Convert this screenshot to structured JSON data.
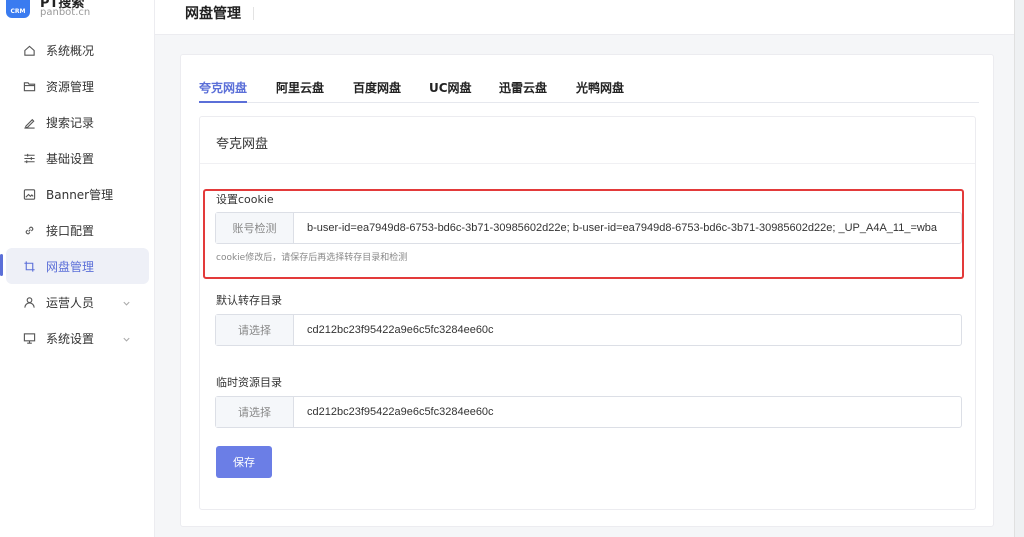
{
  "brand": {
    "logo_text": "CRM",
    "title": "PT搜索",
    "subtitle": "panbot.cn"
  },
  "sidebar": {
    "items": [
      {
        "label": "系统概况",
        "icon": "home-icon"
      },
      {
        "label": "资源管理",
        "icon": "folder-icon"
      },
      {
        "label": "搜索记录",
        "icon": "pen-icon"
      },
      {
        "label": "基础设置",
        "icon": "sliders-icon"
      },
      {
        "label": "Banner管理",
        "icon": "image-icon"
      },
      {
        "label": "接口配置",
        "icon": "link-icon"
      },
      {
        "label": "网盘管理",
        "icon": "crop-icon",
        "active": true
      },
      {
        "label": "运营人员",
        "icon": "user-icon",
        "expandable": true
      },
      {
        "label": "系统设置",
        "icon": "monitor-icon",
        "expandable": true
      }
    ]
  },
  "header": {
    "title": "网盘管理"
  },
  "tabs": [
    {
      "label": "夸克网盘",
      "active": true
    },
    {
      "label": "阿里云盘"
    },
    {
      "label": "百度网盘"
    },
    {
      "label": "UC网盘"
    },
    {
      "label": "迅雷云盘"
    },
    {
      "label": "光鸭网盘"
    }
  ],
  "panel": {
    "title": "夸克网盘",
    "cookie": {
      "label": "设置cookie",
      "addon": "账号检测",
      "value": "b-user-id=ea7949d8-6753-bd6c-3b71-30985602d22e; b-user-id=ea7949d8-6753-bd6c-3b71-30985602d22e; _UP_A4A_11_=wba",
      "hint": "cookie修改后，请保存后再选择转存目录和检测"
    },
    "default_dir": {
      "label": "默认转存目录",
      "addon": "请选择",
      "value": "cd212bc23f95422a9e6c5fc3284ee60c"
    },
    "temp_dir": {
      "label": "临时资源目录",
      "addon": "请选择",
      "value": "cd212bc23f95422a9e6c5fc3284ee60c"
    },
    "save_label": "保存"
  },
  "colors": {
    "accent": "#5b6fd8",
    "button": "#6b7ee6",
    "highlight": "#e33a3a"
  }
}
